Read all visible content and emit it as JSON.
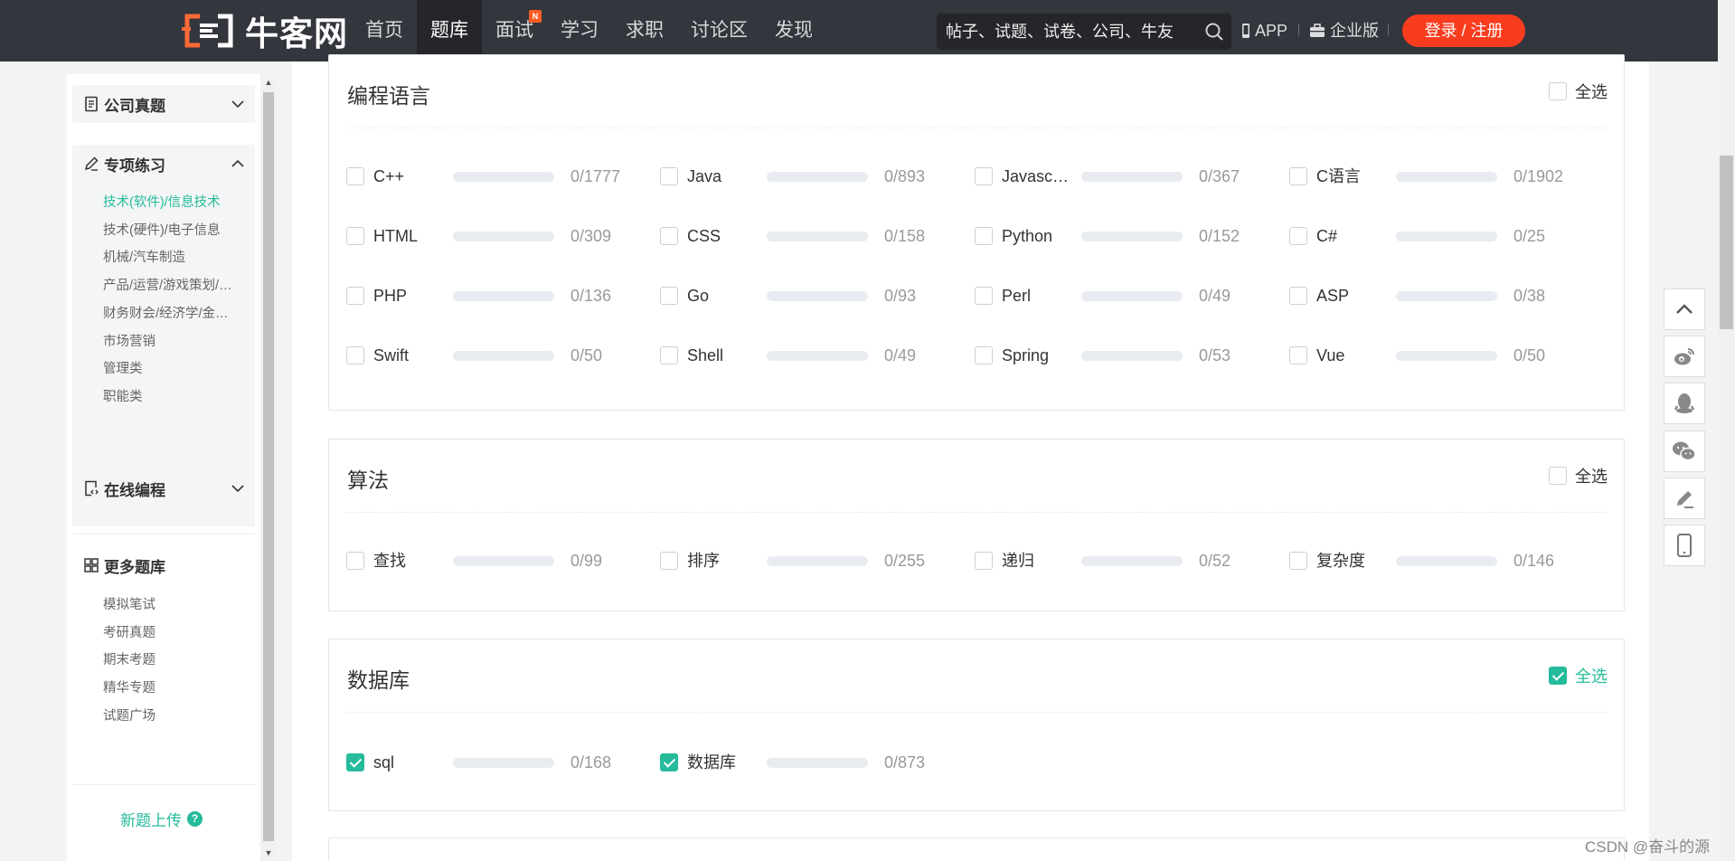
{
  "header": {
    "logo_text": "牛客网",
    "nav": [
      {
        "label": "首页",
        "active": false,
        "badge": ""
      },
      {
        "label": "题库",
        "active": true,
        "badge": ""
      },
      {
        "label": "面试",
        "active": false,
        "badge": "N"
      },
      {
        "label": "学习",
        "active": false,
        "badge": ""
      },
      {
        "label": "求职",
        "active": false,
        "badge": ""
      },
      {
        "label": "讨论区",
        "active": false,
        "badge": ""
      },
      {
        "label": "发现",
        "active": false,
        "badge": ""
      }
    ],
    "search_placeholder": "帖子、试题、试卷、公司、牛友",
    "app_label": "APP",
    "enterprise_label": "企业版",
    "login_label": "登录 / 注册"
  },
  "sidebar": {
    "company": {
      "label": "公司真题",
      "icon": "document-icon"
    },
    "special": {
      "label": "专项练习",
      "icon": "pencil-icon",
      "items": [
        {
          "label": "技术(软件)/信息技术",
          "active": true
        },
        {
          "label": "技术(硬件)/电子信息",
          "active": false
        },
        {
          "label": "机械/汽车制造",
          "active": false
        },
        {
          "label": "产品/运营/游戏策划/…",
          "active": false
        },
        {
          "label": "财务财会/经济学/金…",
          "active": false
        },
        {
          "label": "市场营销",
          "active": false
        },
        {
          "label": "管理类",
          "active": false
        },
        {
          "label": "职能类",
          "active": false
        }
      ]
    },
    "online": {
      "label": "在线编程",
      "icon": "code-doc-icon"
    },
    "more": {
      "label": "更多题库",
      "icon": "grid-icon",
      "items": [
        "模拟笔试",
        "考研真题",
        "期末考题",
        "精华专题",
        "试题广场"
      ]
    },
    "upload_label": "新题上传",
    "upload_help": "?"
  },
  "sections": [
    {
      "title": "编程语言",
      "all_label": "全选",
      "all_checked": false,
      "items": [
        {
          "name": "C++",
          "done": 0,
          "total": 1777,
          "count": "0/1777",
          "checked": false
        },
        {
          "name": "Java",
          "done": 0,
          "total": 893,
          "count": "0/893",
          "checked": false
        },
        {
          "name": "Javasc…",
          "done": 0,
          "total": 367,
          "count": "0/367",
          "checked": false
        },
        {
          "name": "C语言",
          "done": 0,
          "total": 1902,
          "count": "0/1902",
          "checked": false
        },
        {
          "name": "HTML",
          "done": 0,
          "total": 309,
          "count": "0/309",
          "checked": false
        },
        {
          "name": "CSS",
          "done": 0,
          "total": 158,
          "count": "0/158",
          "checked": false
        },
        {
          "name": "Python",
          "done": 0,
          "total": 152,
          "count": "0/152",
          "checked": false
        },
        {
          "name": "C#",
          "done": 0,
          "total": 25,
          "count": "0/25",
          "checked": false
        },
        {
          "name": "PHP",
          "done": 0,
          "total": 136,
          "count": "0/136",
          "checked": false
        },
        {
          "name": "Go",
          "done": 0,
          "total": 93,
          "count": "0/93",
          "checked": false
        },
        {
          "name": "Perl",
          "done": 0,
          "total": 49,
          "count": "0/49",
          "checked": false
        },
        {
          "name": "ASP",
          "done": 0,
          "total": 38,
          "count": "0/38",
          "checked": false
        },
        {
          "name": "Swift",
          "done": 0,
          "total": 50,
          "count": "0/50",
          "checked": false
        },
        {
          "name": "Shell",
          "done": 0,
          "total": 49,
          "count": "0/49",
          "checked": false
        },
        {
          "name": "Spring",
          "done": 0,
          "total": 53,
          "count": "0/53",
          "checked": false
        },
        {
          "name": "Vue",
          "done": 0,
          "total": 50,
          "count": "0/50",
          "checked": false
        }
      ]
    },
    {
      "title": "算法",
      "all_label": "全选",
      "all_checked": false,
      "items": [
        {
          "name": "查找",
          "done": 0,
          "total": 99,
          "count": "0/99",
          "checked": false
        },
        {
          "name": "排序",
          "done": 0,
          "total": 255,
          "count": "0/255",
          "checked": false
        },
        {
          "name": "递归",
          "done": 0,
          "total": 52,
          "count": "0/52",
          "checked": false
        },
        {
          "name": "复杂度",
          "done": 0,
          "total": 146,
          "count": "0/146",
          "checked": false
        }
      ]
    },
    {
      "title": "数据库",
      "all_label": "全选",
      "all_checked": true,
      "items": [
        {
          "name": "sql",
          "done": 0,
          "total": 168,
          "count": "0/168",
          "checked": true
        },
        {
          "name": "数据库",
          "done": 0,
          "total": 873,
          "count": "0/873",
          "checked": true
        }
      ]
    }
  ],
  "float_bar": [
    "arrow-up-icon",
    "weibo-icon",
    "qq-icon",
    "wechat-icon",
    "edit-icon",
    "mobile-icon"
  ],
  "watermark": "CSDN @奋斗的源",
  "colors": {
    "accent": "#25bb9b",
    "header": "#33363c",
    "login": "#fa3c1e"
  }
}
